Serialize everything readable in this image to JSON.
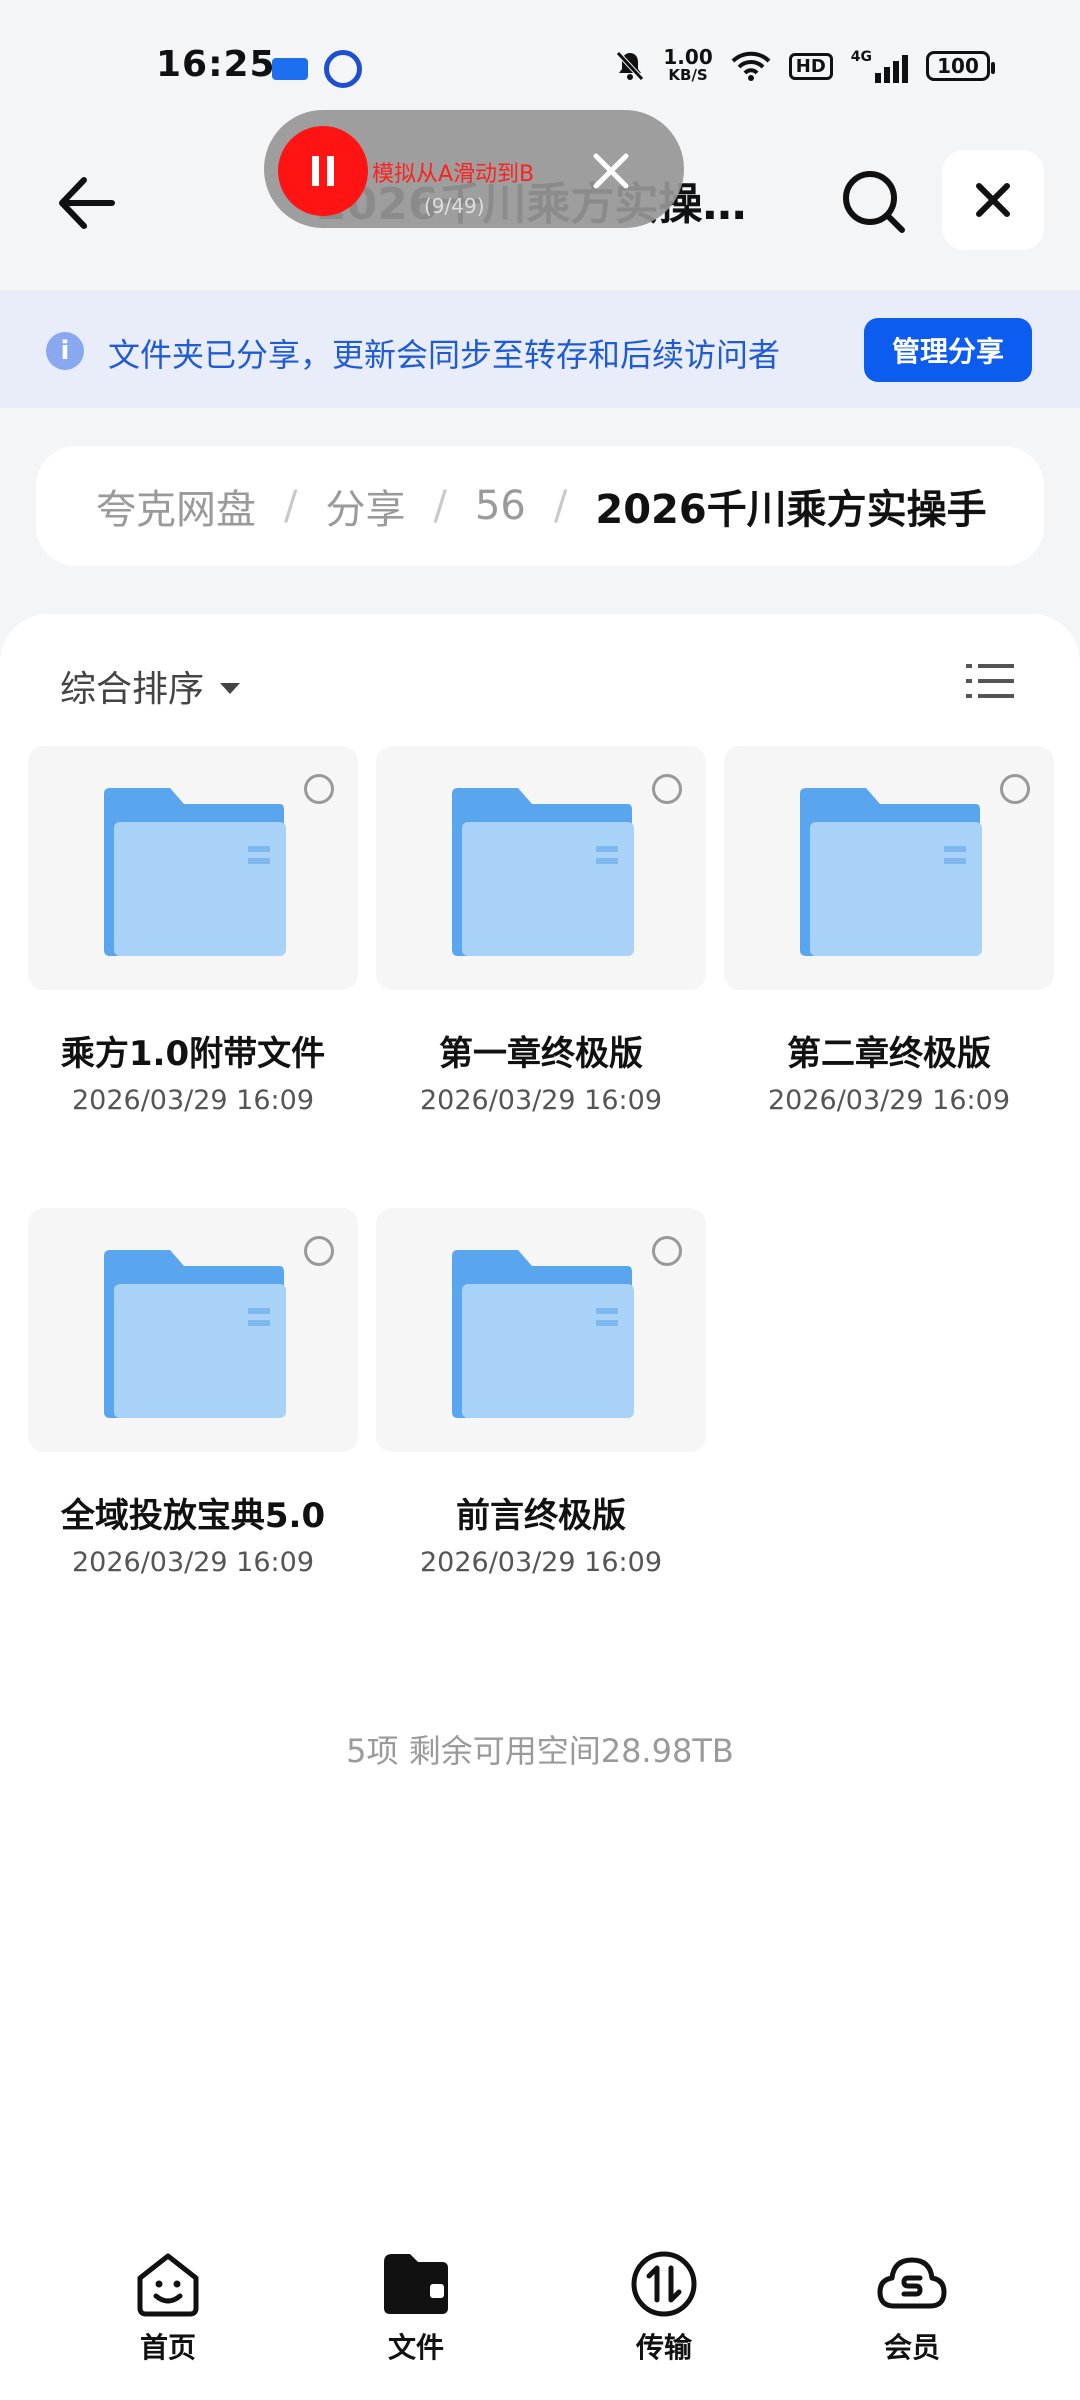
{
  "status_bar": {
    "time": "16:25",
    "net_speed_value": "1.00",
    "net_speed_unit": "KB/S",
    "hd": "HD",
    "signal": "4G",
    "battery": "100"
  },
  "header": {
    "title": "2026千川乘方实操…"
  },
  "recorder": {
    "text": "模拟从A滑动到B",
    "count": "(9/49)"
  },
  "banner": {
    "text": "文件夹已分享，更新会同步至转存和后续访问者",
    "button": "管理分享"
  },
  "breadcrumb": [
    "夸克网盘",
    "分享",
    "56",
    "2026千川乘方实操手"
  ],
  "breadcrumb_separator": "/",
  "toolbar": {
    "sort_label": "综合排序"
  },
  "files": [
    {
      "name": "乘方1.0附带文件",
      "date": "2026/03/29 16:09"
    },
    {
      "name": "第一章终极版",
      "date": "2026/03/29 16:09"
    },
    {
      "name": "第二章终极版",
      "date": "2026/03/29 16:09"
    },
    {
      "name": "全域投放宝典5.0",
      "date": "2026/03/29 16:09"
    },
    {
      "name": "前言终极版",
      "date": "2026/03/29 16:09"
    }
  ],
  "footer": {
    "summary": "5项 剩余可用空间28.98TB"
  },
  "nav": [
    {
      "label": "首页",
      "icon": "home-face-icon"
    },
    {
      "label": "文件",
      "icon": "folder-icon"
    },
    {
      "label": "传输",
      "icon": "transfer-icon"
    },
    {
      "label": "会员",
      "icon": "cloud-vip-icon"
    }
  ],
  "colors": {
    "accent": "#0d5cf0",
    "banner_bg": "#e9edf9",
    "folder_back": "#5aa6ee",
    "folder_front": "#a9d2f8",
    "recorder_red": "#ff1313"
  }
}
